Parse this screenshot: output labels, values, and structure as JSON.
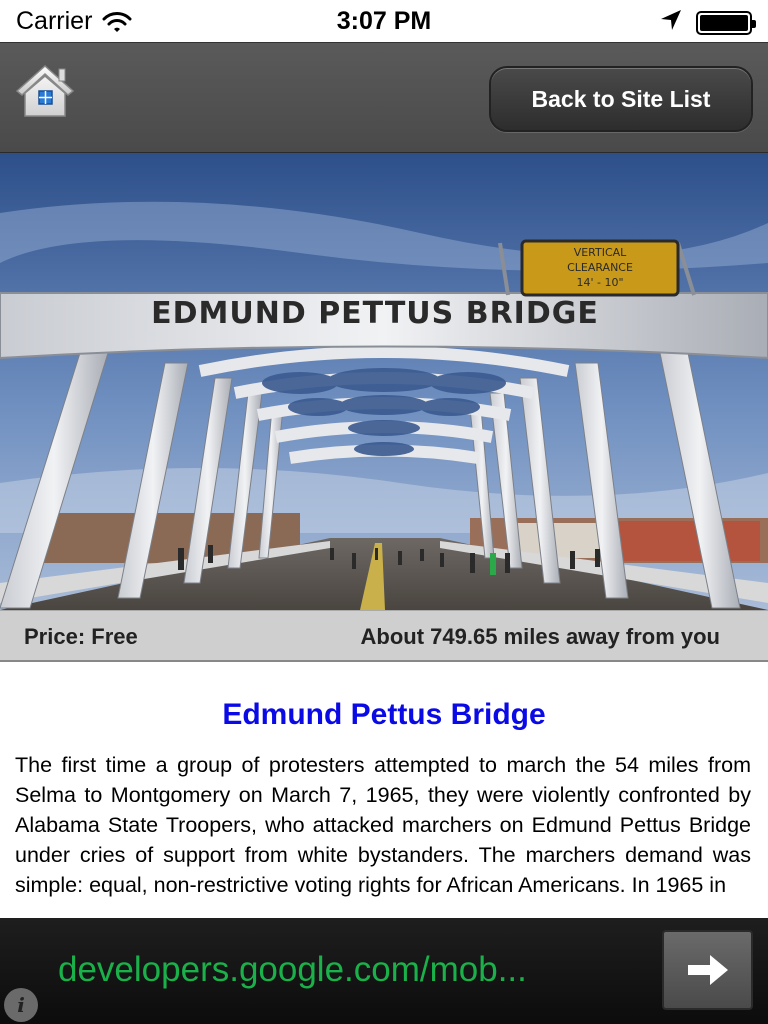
{
  "status_bar": {
    "carrier": "Carrier",
    "time": "3:07 PM",
    "icons": [
      "wifi-icon",
      "location-arrow-icon",
      "battery-icon"
    ]
  },
  "nav_bar": {
    "home_icon": "home-icon",
    "back_label": "Back to Site List"
  },
  "hero": {
    "bridge_sign": "EDMUND PETTUS BRIDGE",
    "clearance_sign": [
      "VERTICAL",
      "CLEARANCE",
      "14' - 10\""
    ]
  },
  "info": {
    "price": "Price: Free",
    "distance": "About 749.65 miles away from you"
  },
  "site": {
    "title": "Edmund Pettus Bridge",
    "description": "The first time a group of protesters attempted to march the 54 miles from Selma to Montgomery on March 7, 1965, they were violently confronted by Alabama State Troopers, who attacked marchers on Edmund Pettus Bridge under cries of support from white bystanders. The marchers demand was simple: equal, non-restrictive voting rights for African Americans. In 1965 in"
  },
  "ad": {
    "text": "developers.google.com/mob...",
    "arrow_icon": "arrow-right-icon",
    "info_icon": "info-icon",
    "colors": {
      "text": "#1bb14a",
      "background": "#151515"
    }
  },
  "colors": {
    "title": "#0a0ae6",
    "nav_bar": "#525252",
    "info_bar": "#cfcfcf"
  }
}
